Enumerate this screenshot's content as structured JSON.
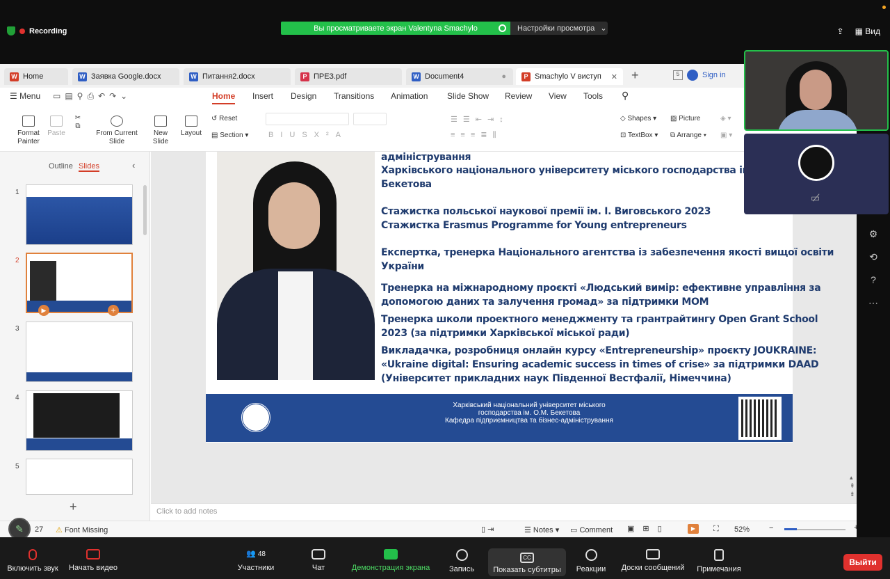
{
  "zoom": {
    "recording_label": "Recording",
    "share_banner": "Вы просматриваете экран Valentyna Smachylo",
    "view_options": "Настройки просмотра",
    "view_label": "Вид",
    "toolbar": [
      {
        "label": "Включить звук",
        "icon": "mic-off-icon"
      },
      {
        "label": "Начать видео",
        "icon": "video-off-icon"
      },
      {
        "label": "Участники",
        "count": "48",
        "icon": "participants-icon"
      },
      {
        "label": "Чат",
        "icon": "chat-icon"
      },
      {
        "label": "Демонстрация экрана",
        "icon": "share-screen-icon"
      },
      {
        "label": "Запись",
        "icon": "record-icon"
      },
      {
        "label": "Показать субтитры",
        "icon": "cc-icon"
      },
      {
        "label": "Реакции",
        "icon": "reactions-icon"
      },
      {
        "label": "Доски сообщений",
        "icon": "whiteboard-icon"
      },
      {
        "label": "Примечания",
        "icon": "notes-icon"
      }
    ],
    "leave_label": "Выйти"
  },
  "tabs": [
    {
      "label": "Home",
      "icon": "wps-icon"
    },
    {
      "label": "Заявка Google.docx",
      "icon": "word-icon"
    },
    {
      "label": "Питання2.docx",
      "icon": "word-icon"
    },
    {
      "label": "ПРЕЗ.pdf",
      "icon": "pdf-icon"
    },
    {
      "label": "Document4",
      "icon": "word-icon"
    },
    {
      "label": "Smachylo V виступ",
      "icon": "ppt-icon"
    }
  ],
  "sign_in": "Sign in",
  "menu": {
    "menu_label": "Menu",
    "items": [
      "Home",
      "Insert",
      "Design",
      "Transitions",
      "Animation",
      "Slide Show",
      "Review",
      "View",
      "Tools"
    ]
  },
  "ribbon": {
    "format_painter": "Format Painter",
    "paste": "Paste",
    "from_current_slide": "From Current Slide",
    "new_slide": "New Slide",
    "layout": "Layout",
    "reset": "Reset",
    "section": "Section",
    "shapes": "Shapes",
    "picture": "Picture",
    "textbox": "TextBox",
    "arrange": "Arrange"
  },
  "panel": {
    "outline": "Outline",
    "slides": "Slides",
    "slide_numbers": [
      "1",
      "2",
      "3",
      "4",
      "5"
    ]
  },
  "slide": {
    "lines": [
      "адміністрування",
      "Харківського національного університету міського господарства ім. О.М.",
      "Бекетова",
      "Стажистка польської наукової премії ім. І. Виговського 2023",
      "Стажистка Erasmus Programme for Young entrepreneurs",
      "Експертка, тренерка Національного агентства із забезпечення якості вищої освіти",
      "України",
      "Тренерка на міжнародному проєкті «Людський вимір: ефективне управління за",
      "допомогою даних та залучення громад» за підтримки МОМ",
      "Тренерка школи проектного менеджменту та грантрайтингу Open Grant School",
      "2023 (за підтримки Харківської міської ради)",
      "Викладачка, розробниця онлайн курсу «Entrepreneurship» проєкту JOUKRAINE:",
      "«Ukraine digital: Ensuring academic success in times of crise» за підтримки DAAD",
      "(Університет прикладних наук Південної Вестфалії, Німеччина)"
    ],
    "footer": [
      "Харківський національний університет міського",
      "господарства ім. О.М. Бекетова",
      "Кафедра підприємництва та бізнес-адміністрування"
    ]
  },
  "notes_placeholder": "Click to add notes",
  "status": {
    "slide_count": "27",
    "font_missing": "Font Missing",
    "notes": "Notes",
    "comment": "Comment",
    "zoom": "52%"
  },
  "colors": {
    "accent": "#d33d27",
    "slide_blue": "#244b93",
    "zoom_green": "#23c04a",
    "leave_red": "#e0312e"
  }
}
